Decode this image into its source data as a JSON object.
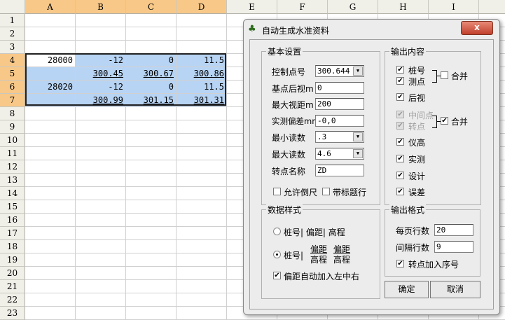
{
  "sheet": {
    "columns": [
      "A",
      "B",
      "C",
      "D",
      "E",
      "F",
      "G",
      "H",
      "I"
    ],
    "selected_columns": [
      "A",
      "B",
      "C",
      "D"
    ],
    "rows": [
      "1",
      "2",
      "3",
      "4",
      "5",
      "6",
      "7",
      "8",
      "9",
      "10",
      "11",
      "12",
      "13",
      "14",
      "15",
      "16",
      "17",
      "18",
      "19",
      "20",
      "21",
      "22",
      "23"
    ],
    "selected_rows": [
      "4",
      "5",
      "6",
      "7"
    ],
    "cells": [
      {
        "ref": "A4",
        "value": "28000"
      },
      {
        "ref": "B4",
        "value": "-12"
      },
      {
        "ref": "C4",
        "value": "0"
      },
      {
        "ref": "D4",
        "value": "11.5"
      },
      {
        "ref": "B5",
        "value": "300.45"
      },
      {
        "ref": "C5",
        "value": "300.67"
      },
      {
        "ref": "D5",
        "value": "300.86"
      },
      {
        "ref": "A6",
        "value": "28020"
      },
      {
        "ref": "B6",
        "value": "-12"
      },
      {
        "ref": "C6",
        "value": "0"
      },
      {
        "ref": "D6",
        "value": "11.5"
      },
      {
        "ref": "B7",
        "value": "300.99"
      },
      {
        "ref": "C7",
        "value": "301.15"
      },
      {
        "ref": "D7",
        "value": "301.31"
      }
    ]
  },
  "dialog": {
    "title": "自动生成水准资料",
    "close": "x",
    "basic": {
      "title": "基本设置",
      "control_point_label": "控制点号",
      "control_point_value": "300.644",
      "base_backsight_label": "基点后视m",
      "base_backsight_value": "0",
      "max_sight_label": "最大视距m",
      "max_sight_value": "200",
      "measured_dev_label": "实测偏差mm",
      "measured_dev_value": "-0,0",
      "min_read_label": "最小读数",
      "min_read_value": ".3",
      "max_read_label": "最大读数",
      "max_read_value": "4.6",
      "turn_name_label": "转点名称",
      "turn_name_value": "ZD",
      "allow_inverted": "允许倒尺",
      "with_header": "带标题行"
    },
    "output": {
      "title": "输出内容",
      "items": [
        "桩号",
        "测点",
        "后视",
        "中间点",
        "转点",
        "仪高",
        "实测",
        "设计",
        "误差"
      ],
      "merge1": "合并",
      "merge2": "合并"
    },
    "style": {
      "title": "数据样式",
      "opt1": "桩号| 偏距| 高程",
      "opt2_a": "桩号|",
      "opt2_b1": "偏距",
      "opt2_b2": "高程",
      "opt2_c1": "偏距",
      "opt2_c2": "高程",
      "auto_lr": "偏距自动加入左中右"
    },
    "format": {
      "title": "输出格式",
      "per_page_label": "每页行数",
      "per_page_value": "20",
      "interval_label": "间隔行数",
      "interval_value": "9",
      "seq": "转点加入序号"
    },
    "ok": "确定",
    "cancel": "取消"
  },
  "check": "✔",
  "arrow": "▼"
}
